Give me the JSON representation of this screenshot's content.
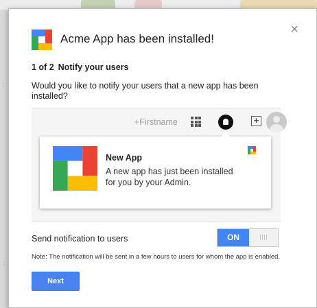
{
  "dialog": {
    "title": "Acme App has been installed!",
    "close_glyph": "×",
    "step_count": "1 of 2",
    "step_title": "Notify your users",
    "question": "Would you like to notify your users that a new app has been installed?",
    "preview": {
      "user_name": "+Firstname",
      "icons": [
        "apps-grid-icon",
        "notification-bell-icon",
        "add-box-icon",
        "user-avatar-icon"
      ],
      "notification": {
        "title": "New App",
        "text": "A new app has just been installed for you by your Admin."
      }
    },
    "send_label": "Send notification to users",
    "toggle_state": "ON",
    "note": "Note: The notification will be sent in a few hours to users for whom the app is enabled.",
    "next_label": "Next"
  },
  "colors": {
    "logo_blue": "#4285f4",
    "logo_green": "#34a853",
    "logo_red": "#ea4335",
    "logo_yellow": "#fbbc05",
    "accent": "#4285f4"
  }
}
